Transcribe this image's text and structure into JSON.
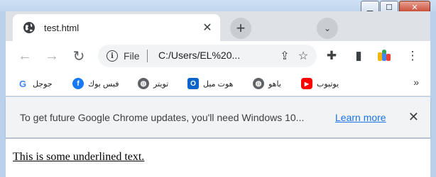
{
  "window": {
    "minimize_label": "▁",
    "maximize_label": "☐",
    "close_label": "✕"
  },
  "tab": {
    "title": "test.html",
    "close_label": "✕",
    "new_tab_label": "+",
    "tab_search_label": "⌄"
  },
  "toolbar": {
    "back_icon": "←",
    "forward_icon": "→",
    "reload_icon": "↻",
    "site_info_icon": "i",
    "site_label": "File",
    "url": "C:/Users/EL%20...",
    "share_icon": "⇪",
    "bookmark_icon": "☆",
    "extensions_icon": "✚",
    "side_panel_icon": "▮",
    "menu_icon": "⋮"
  },
  "bookmarks": {
    "items": [
      {
        "label": "جوجل",
        "icon": "google-icon",
        "color": "#4285f4",
        "glyph": "G"
      },
      {
        "label": "فيس بوك",
        "icon": "facebook-icon",
        "color": "#1877f2",
        "glyph": "f"
      },
      {
        "label": "تويتر",
        "icon": "globe-icon",
        "color": "#5f6368",
        "glyph": "◍"
      },
      {
        "label": "هوت ميل",
        "icon": "outlook-icon",
        "color": "#0a64c9",
        "glyph": "O"
      },
      {
        "label": "ياهو",
        "icon": "globe-icon",
        "color": "#5f6368",
        "glyph": "◍"
      },
      {
        "label": "يوتيوب",
        "icon": "youtube-icon",
        "color": "#ff0000",
        "glyph": "▶"
      }
    ],
    "more_label": "»"
  },
  "infobar": {
    "message": "To get future Google Chrome updates, you'll need Windows 10...",
    "link": "Learn more",
    "close_label": "✕"
  },
  "page": {
    "text": "This is some underlined text."
  }
}
